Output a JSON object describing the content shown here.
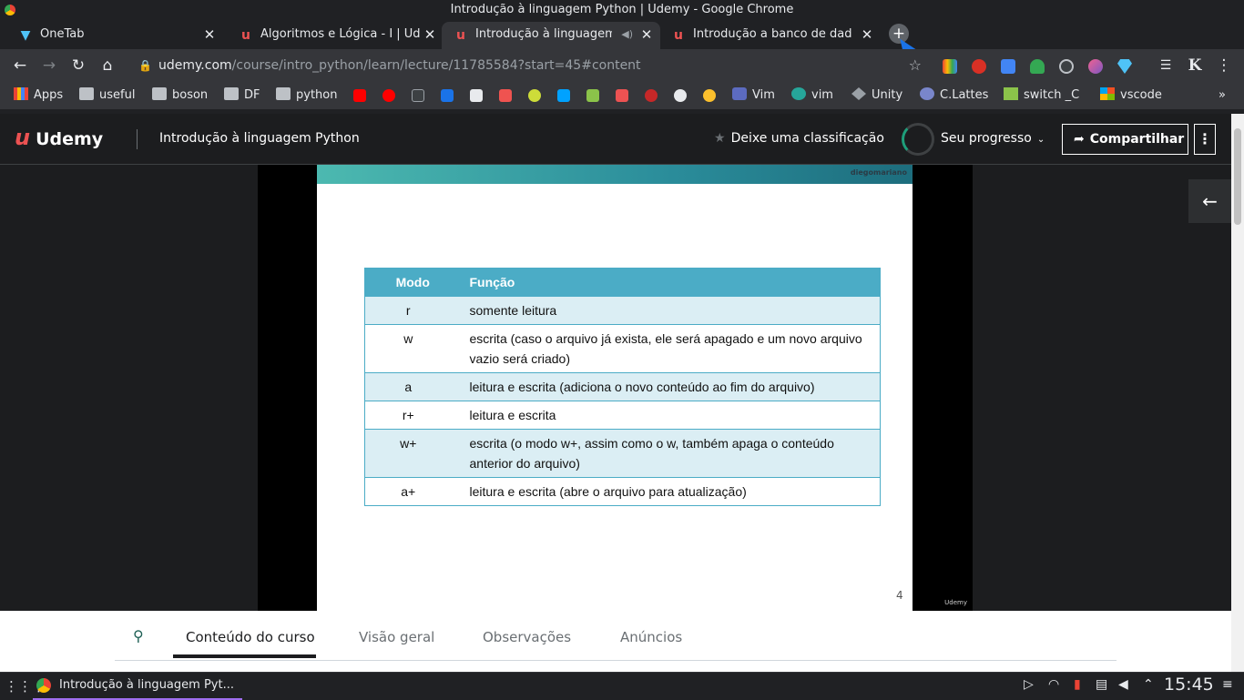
{
  "window": {
    "title": "Introdução à linguagem Python | Udemy - Google Chrome"
  },
  "tabs": [
    {
      "title": "OneTab",
      "favicon": "onetab-icon"
    },
    {
      "title": "Algoritmos e Lógica - I | Ud",
      "favicon": "udemy-icon"
    },
    {
      "title": "Introdução à linguagem",
      "favicon": "udemy-icon",
      "active": true,
      "audio": true
    },
    {
      "title": "Introdução a banco de dad",
      "favicon": "udemy-icon"
    }
  ],
  "omnibox": {
    "host": "udemy.com",
    "path": "/course/intro_python/learn/lecture/11785584?start=45#content"
  },
  "bookmarks": [
    {
      "label": "Apps",
      "icon": "apps-grid-icon"
    },
    {
      "label": "useful",
      "icon": "folder-icon"
    },
    {
      "label": "boson",
      "icon": "folder-icon"
    },
    {
      "label": "DF",
      "icon": "folder-icon"
    },
    {
      "label": "python",
      "icon": "folder-icon"
    },
    {
      "label": "Vim",
      "icon": "vim-icon"
    },
    {
      "label": "vim",
      "icon": "vim-icon"
    },
    {
      "label": "Unity",
      "icon": "unity-icon"
    },
    {
      "label": "C.Lattes",
      "icon": "lattes-icon"
    },
    {
      "label": "switch _C",
      "icon": "switch-icon"
    },
    {
      "label": "vscode",
      "icon": "vscode-icon"
    }
  ],
  "header": {
    "logo": "Udemy",
    "course_title": "Introdução à linguagem Python",
    "rating_cta": "Deixe uma classificação",
    "progress_label": "Seu progresso",
    "share_label": "Compartilhar"
  },
  "slide": {
    "brand": "diegomariano",
    "page_number": "4",
    "watermark": "Udemy",
    "headers": [
      "Modo",
      "Função"
    ],
    "rows": [
      [
        "r",
        "somente leitura"
      ],
      [
        "w",
        "escrita (caso o arquivo já exista, ele será apagado e um novo arquivo vazio será criado)"
      ],
      [
        "a",
        "leitura e escrita (adiciona o novo conteúdo ao fim do arquivo)"
      ],
      [
        "r+",
        "leitura e escrita"
      ],
      [
        "w+",
        "escrita (o modo w+, assim como o w, também apaga o conteúdo anterior do arquivo)"
      ],
      [
        "a+",
        "leitura e escrita (abre o arquivo para atualização)"
      ]
    ]
  },
  "bottom_tabs": [
    "Conteúdo do curso",
    "Visão geral",
    "Observações",
    "Anúncios"
  ],
  "taskbar": {
    "task": "Introdução à linguagem Pyt...",
    "clock": "15:45"
  },
  "colors": {
    "udemy_red": "#ec5252",
    "table_header": "#4bacc6",
    "table_stripe": "#dbeef4"
  }
}
